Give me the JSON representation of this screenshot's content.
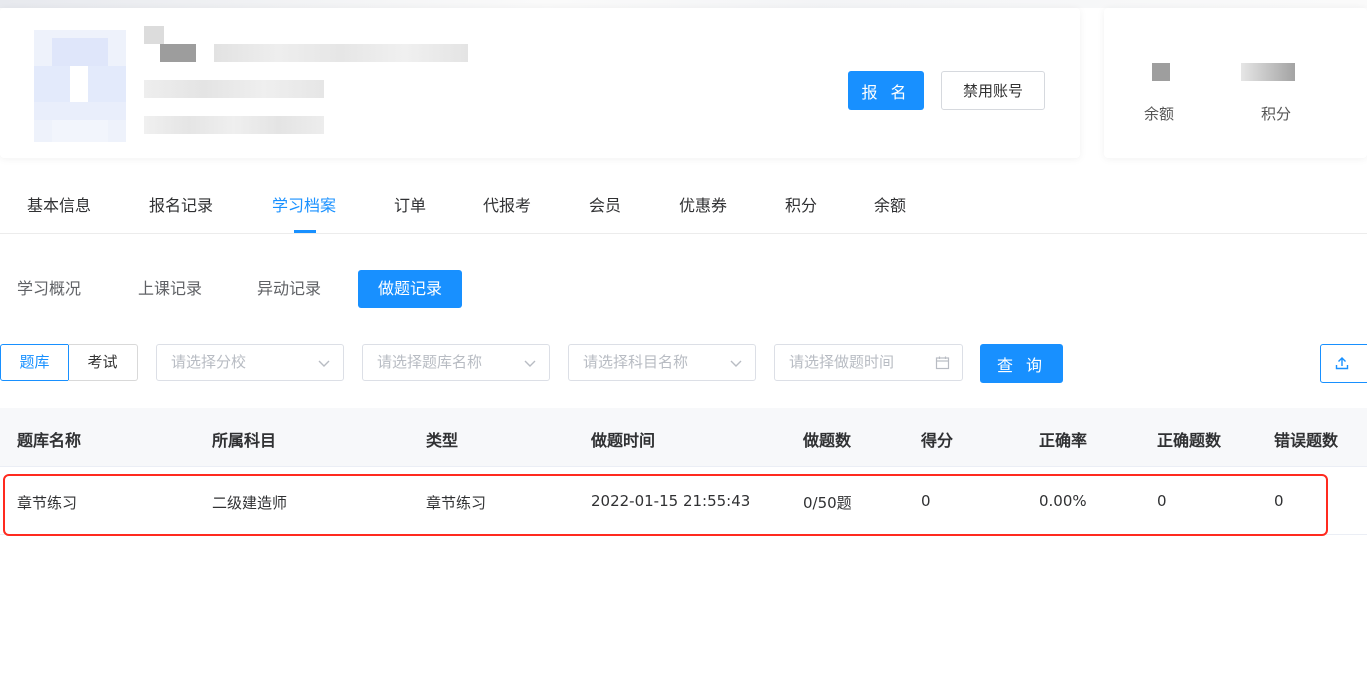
{
  "header": {
    "signup_label": "报 名",
    "disable_label": "禁用账号"
  },
  "stats": {
    "balance_label": "余额",
    "points_label": "积分"
  },
  "main_tabs": [
    {
      "label": "基本信息"
    },
    {
      "label": "报名记录"
    },
    {
      "label": "学习档案",
      "active": true
    },
    {
      "label": "订单"
    },
    {
      "label": "代报考"
    },
    {
      "label": "会员"
    },
    {
      "label": "优惠券"
    },
    {
      "label": "积分"
    },
    {
      "label": "余额"
    }
  ],
  "sub_tabs": [
    {
      "label": "学习概况"
    },
    {
      "label": "上课记录"
    },
    {
      "label": "异动记录"
    },
    {
      "label": "做题记录",
      "active": true
    }
  ],
  "filters": {
    "segment_bank": "题库",
    "segment_exam": "考试",
    "school_placeholder": "请选择分校",
    "bank_placeholder": "请选择题库名称",
    "subject_placeholder": "请选择科目名称",
    "time_placeholder": "请选择做题时间",
    "query_label": "查 询"
  },
  "table": {
    "columns": [
      "题库名称",
      "所属科目",
      "类型",
      "做题时间",
      "做题数",
      "得分",
      "正确率",
      "正确题数",
      "错误题数"
    ],
    "rows": [
      [
        "章节练习",
        "二级建造师",
        "章节练习",
        "2022-01-15 21:55:43",
        "0/50题",
        "0",
        "0.00%",
        "0",
        "0"
      ]
    ]
  },
  "colors": {
    "primary": "#1890ff",
    "highlight_border": "#ff2a1f"
  },
  "icons": {
    "caret": "chevron-down-icon",
    "calendar": "calendar-icon",
    "export": "upload-icon"
  }
}
